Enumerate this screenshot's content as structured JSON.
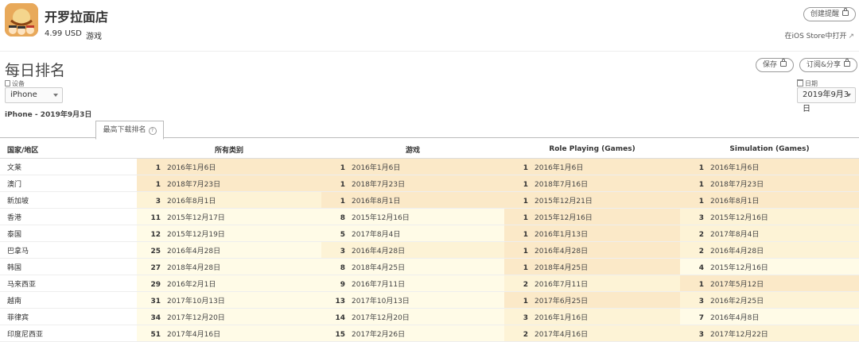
{
  "app": {
    "name": "开罗拉面店",
    "price": "4.99 USD",
    "category": "游戏",
    "create_alert": "创建提醒",
    "store_link": "在iOS Store中打开",
    "ext_icon": "↗"
  },
  "section": {
    "title": "每日排名",
    "save_label": "保存",
    "subscribe_label": "订阅&分享",
    "device_label": "设备",
    "device_value": "iPhone",
    "date_label": "日期",
    "date_value": "2019年9月3日",
    "device_date": "iPhone - 2019年9月3日",
    "tab_label": "最高下载排名",
    "tab_help": "?"
  },
  "colors": {
    "rank1": "#fbe9c8",
    "rank_mid": "#fdf3d6",
    "rank_low": "#fffbe7"
  },
  "table": {
    "headers": [
      "国家/地区",
      "所有类别",
      "游戏",
      "Role Playing (Games)",
      "Simulation (Games)"
    ],
    "rows": [
      {
        "country": "文莱",
        "cells": [
          [
            "1",
            "2016年1月6日"
          ],
          [
            "1",
            "2016年1月6日"
          ],
          [
            "1",
            "2016年1月6日"
          ],
          [
            "1",
            "2016年1月6日"
          ]
        ]
      },
      {
        "country": "澳门",
        "cells": [
          [
            "1",
            "2018年7月23日"
          ],
          [
            "1",
            "2018年7月23日"
          ],
          [
            "1",
            "2018年7月16日"
          ],
          [
            "1",
            "2018年7月23日"
          ]
        ]
      },
      {
        "country": "新加坡",
        "cells": [
          [
            "3",
            "2016年8月1日"
          ],
          [
            "1",
            "2016年8月1日"
          ],
          [
            "1",
            "2015年12月21日"
          ],
          [
            "1",
            "2016年8月1日"
          ]
        ]
      },
      {
        "country": "香港",
        "cells": [
          [
            "11",
            "2015年12月17日"
          ],
          [
            "8",
            "2015年12月16日"
          ],
          [
            "1",
            "2015年12月16日"
          ],
          [
            "3",
            "2015年12月16日"
          ]
        ]
      },
      {
        "country": "泰国",
        "cells": [
          [
            "12",
            "2015年12月19日"
          ],
          [
            "5",
            "2017年8月4日"
          ],
          [
            "1",
            "2016年1月13日"
          ],
          [
            "2",
            "2017年8月4日"
          ]
        ]
      },
      {
        "country": "巴拿马",
        "cells": [
          [
            "25",
            "2016年4月28日"
          ],
          [
            "3",
            "2016年4月28日"
          ],
          [
            "1",
            "2016年4月28日"
          ],
          [
            "2",
            "2016年4月28日"
          ]
        ]
      },
      {
        "country": "韩国",
        "cells": [
          [
            "27",
            "2018年4月28日"
          ],
          [
            "8",
            "2018年4月25日"
          ],
          [
            "1",
            "2018年4月25日"
          ],
          [
            "4",
            "2015年12月16日"
          ]
        ]
      },
      {
        "country": "马来西亚",
        "cells": [
          [
            "29",
            "2016年2月1日"
          ],
          [
            "9",
            "2016年7月11日"
          ],
          [
            "2",
            "2016年7月11日"
          ],
          [
            "1",
            "2017年5月12日"
          ]
        ]
      },
      {
        "country": "越南",
        "cells": [
          [
            "31",
            "2017年10月13日"
          ],
          [
            "13",
            "2017年10月13日"
          ],
          [
            "1",
            "2017年6月25日"
          ],
          [
            "3",
            "2016年2月25日"
          ]
        ]
      },
      {
        "country": "菲律宾",
        "cells": [
          [
            "34",
            "2017年12月20日"
          ],
          [
            "14",
            "2017年12月20日"
          ],
          [
            "3",
            "2016年1月16日"
          ],
          [
            "7",
            "2016年4月8日"
          ]
        ]
      },
      {
        "country": "印度尼西亚",
        "cells": [
          [
            "51",
            "2017年4月16日"
          ],
          [
            "15",
            "2017年2月26日"
          ],
          [
            "2",
            "2017年4月16日"
          ],
          [
            "3",
            "2017年12月22日"
          ]
        ]
      }
    ]
  }
}
